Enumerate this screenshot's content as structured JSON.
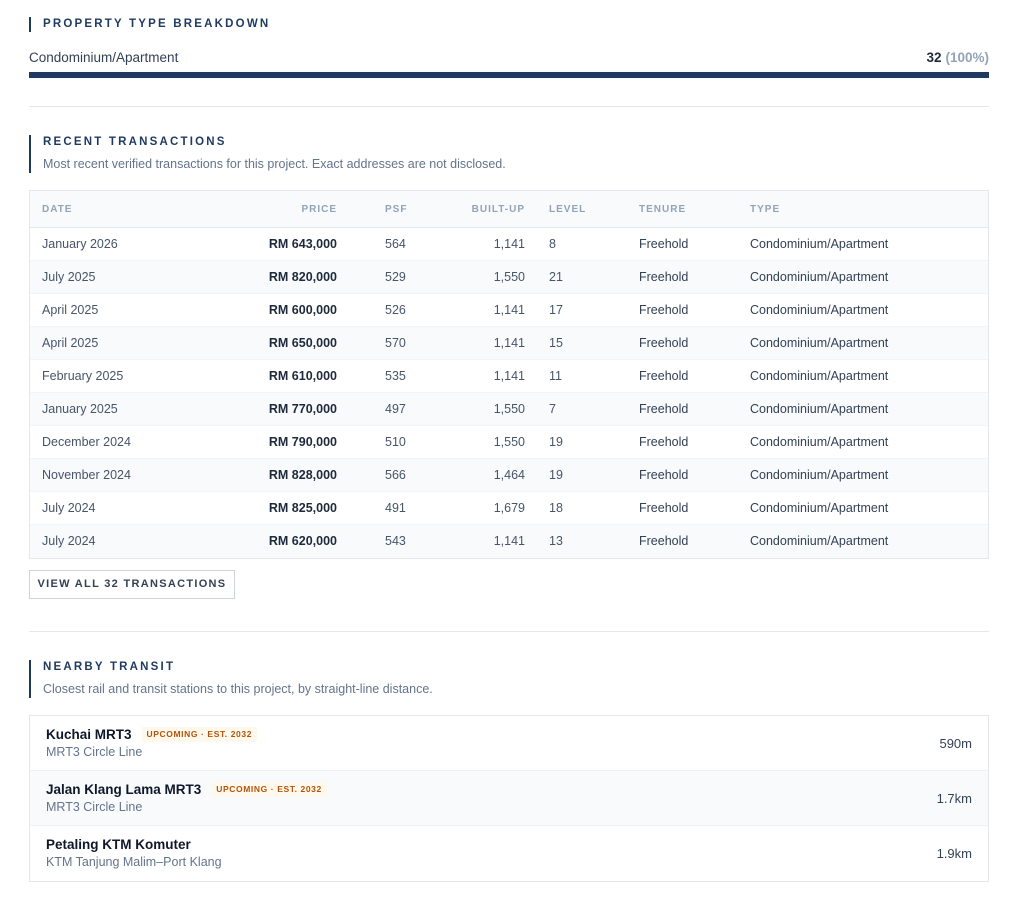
{
  "property_type_breakdown": {
    "title": "PROPERTY TYPE BREAKDOWN",
    "items": [
      {
        "label": "Condominium/Apartment",
        "count": "32",
        "percent_text": "(100%)",
        "share": 1.0
      }
    ]
  },
  "recent_transactions": {
    "title": "RECENT TRANSACTIONS",
    "subtitle": "Most recent verified transactions for this project. Exact addresses are not disclosed.",
    "columns": [
      "DATE",
      "PRICE",
      "PSF",
      "BUILT-UP",
      "LEVEL",
      "TENURE",
      "TYPE"
    ],
    "rows": [
      {
        "date": "January 2026",
        "price": "RM 643,000",
        "psf": "564",
        "built_up": "1,141",
        "level": "8",
        "tenure": "Freehold",
        "type": "Condominium/Apartment"
      },
      {
        "date": "July 2025",
        "price": "RM 820,000",
        "psf": "529",
        "built_up": "1,550",
        "level": "21",
        "tenure": "Freehold",
        "type": "Condominium/Apartment"
      },
      {
        "date": "April 2025",
        "price": "RM 600,000",
        "psf": "526",
        "built_up": "1,141",
        "level": "17",
        "tenure": "Freehold",
        "type": "Condominium/Apartment"
      },
      {
        "date": "April 2025",
        "price": "RM 650,000",
        "psf": "570",
        "built_up": "1,141",
        "level": "15",
        "tenure": "Freehold",
        "type": "Condominium/Apartment"
      },
      {
        "date": "February 2025",
        "price": "RM 610,000",
        "psf": "535",
        "built_up": "1,141",
        "level": "11",
        "tenure": "Freehold",
        "type": "Condominium/Apartment"
      },
      {
        "date": "January 2025",
        "price": "RM 770,000",
        "psf": "497",
        "built_up": "1,550",
        "level": "7",
        "tenure": "Freehold",
        "type": "Condominium/Apartment"
      },
      {
        "date": "December 2024",
        "price": "RM 790,000",
        "psf": "510",
        "built_up": "1,550",
        "level": "19",
        "tenure": "Freehold",
        "type": "Condominium/Apartment"
      },
      {
        "date": "November 2024",
        "price": "RM 828,000",
        "psf": "566",
        "built_up": "1,464",
        "level": "19",
        "tenure": "Freehold",
        "type": "Condominium/Apartment"
      },
      {
        "date": "July 2024",
        "price": "RM 825,000",
        "psf": "491",
        "built_up": "1,679",
        "level": "18",
        "tenure": "Freehold",
        "type": "Condominium/Apartment"
      },
      {
        "date": "July 2024",
        "price": "RM 620,000",
        "psf": "543",
        "built_up": "1,141",
        "level": "13",
        "tenure": "Freehold",
        "type": "Condominium/Apartment"
      }
    ],
    "view_all_label": "VIEW ALL 32 TRANSACTIONS"
  },
  "nearby_transit": {
    "title": "NEARBY TRANSIT",
    "subtitle": "Closest rail and transit stations to this project, by straight-line distance.",
    "stations": [
      {
        "name": "Kuchai MRT3",
        "badge": "UPCOMING · EST. 2032",
        "line": "MRT3 Circle Line",
        "distance": "590m"
      },
      {
        "name": "Jalan Klang Lama MRT3",
        "badge": "UPCOMING · EST. 2032",
        "line": "MRT3 Circle Line",
        "distance": "1.7km"
      },
      {
        "name": "Petaling KTM Komuter",
        "badge": "",
        "line": "KTM Tanjung Malim–Port Klang",
        "distance": "1.9km"
      }
    ]
  },
  "colors": {
    "accent": "#1e3a5f",
    "badge_text": "#b45309",
    "badge_bg": "#fef9ec"
  }
}
